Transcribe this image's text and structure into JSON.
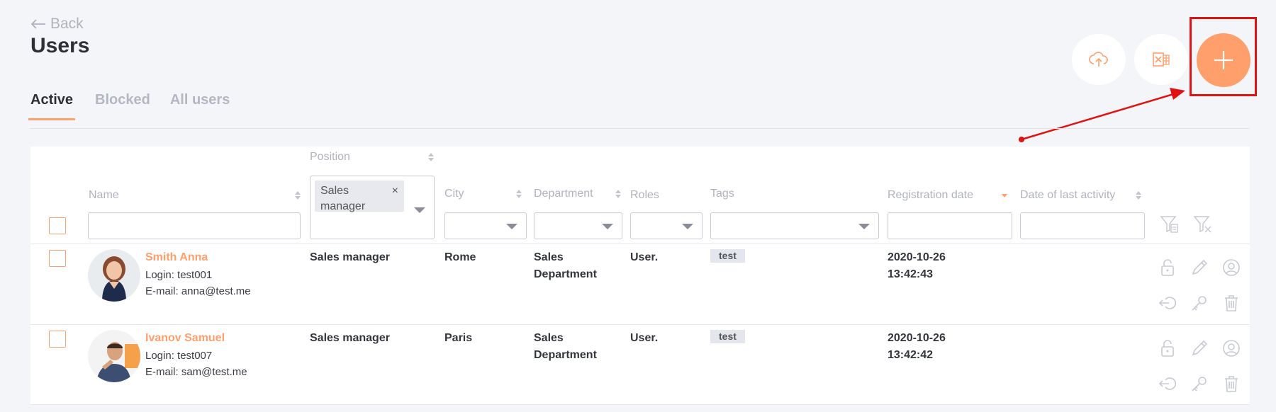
{
  "header": {
    "back_label": "Back",
    "title": "Users"
  },
  "toolbar": {
    "upload_icon": "cloud-upload-icon",
    "excel_icon": "excel-export-icon",
    "add_icon": "plus-icon",
    "accent_color": "#ff9f6c",
    "highlight_color": "#e01212"
  },
  "tabs": [
    {
      "label": "Active"
    },
    {
      "label": "Blocked"
    },
    {
      "label": "All users"
    }
  ],
  "columns": {
    "name": "Name",
    "position": "Position",
    "city": "City",
    "department": "Department",
    "roles": "Roles",
    "tags": "Tags",
    "registration_date": "Registration date",
    "last_activity": "Date of last activity"
  },
  "filters": {
    "position_chip_line1": "Sales",
    "position_chip_line2": "manager",
    "position_chip_remove": "×"
  },
  "users": [
    {
      "name": "Smith Anna",
      "login": "Login: test001",
      "email": "E-mail: anna@test.me",
      "position": "Sales manager",
      "city": "Rome",
      "department_line1": "Sales",
      "department_line2": "Department",
      "roles": "User.",
      "tag": "test",
      "reg_date": "2020-10-26",
      "reg_time": "13:42:43"
    },
    {
      "name": "Ivanov Samuel",
      "login": "Login: test007",
      "email": "E-mail: sam@test.me",
      "position": "Sales manager",
      "city": "Paris",
      "department_line1": "Sales",
      "department_line2": "Department",
      "roles": "User.",
      "tag": "test",
      "reg_date": "2020-10-26",
      "reg_time": "13:42:42"
    }
  ]
}
